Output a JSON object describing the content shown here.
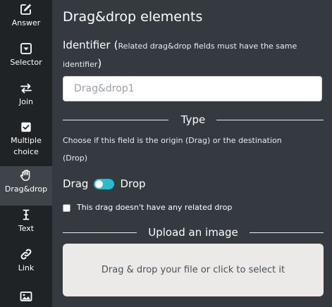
{
  "sidebar": {
    "items": [
      {
        "label": "Answer",
        "icon": "pencil-square-icon"
      },
      {
        "label": "Selector",
        "icon": "caret-square-down-icon"
      },
      {
        "label": "Join",
        "icon": "exchange-arrows-icon"
      },
      {
        "label": "Multiple\nchoice",
        "label_line1": "Multiple",
        "label_line2": "choice",
        "icon": "check-square-icon"
      },
      {
        "label": "Drag&drop",
        "icon": "hand-paper-icon",
        "active": true
      },
      {
        "label": "Text",
        "icon": "i-cursor-icon"
      },
      {
        "label": "Link",
        "icon": "link-icon"
      },
      {
        "label": "",
        "icon": "image-icon"
      }
    ]
  },
  "main": {
    "title": "Drag&drop elements",
    "identifier": {
      "label": "Identifier",
      "note_open": "(",
      "note": "Related drag&drop fields must have the same identifier",
      "note_close": ")",
      "placeholder": "Drag&drop1",
      "value": ""
    },
    "type_section": {
      "heading": "Type",
      "description": "Choose if this field is the origin (Drag) or the destination (Drop)",
      "toggle_left": "Drag",
      "toggle_right": "Drop",
      "toggle_state": "Drag"
    },
    "no_related_drop": {
      "label": "This drag doesn't have any related drop",
      "checked": false
    },
    "upload_section": {
      "heading": "Upload an image",
      "dropzone_text": "Drag & drop your file or click to select it"
    }
  },
  "colors": {
    "sidebar_bg": "#1f2326",
    "sidebar_active_bg": "#3e444a",
    "main_bg": "#343a40",
    "toggle_accent": "#2bbccb",
    "dropzone_bg": "#eceae8"
  }
}
